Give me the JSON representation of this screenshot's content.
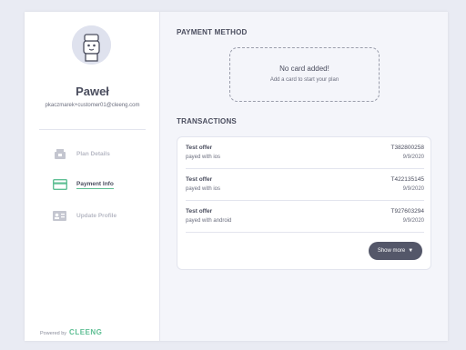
{
  "user": {
    "name": "Paweł",
    "email": "pkaczmarek+customer01@cleeng.com"
  },
  "nav": [
    {
      "label": "Plan Details",
      "icon": "plan-details-icon",
      "active": false
    },
    {
      "label": "Payment Info",
      "icon": "credit-card-icon",
      "active": true
    },
    {
      "label": "Update Profile",
      "icon": "profile-card-icon",
      "active": false
    }
  ],
  "footer": {
    "powered_by": "Powered by",
    "brand": "CLEENG"
  },
  "payment_method": {
    "title": "PAYMENT METHOD",
    "empty_title": "No card added!",
    "empty_subtitle": "Add a card to start your plan"
  },
  "transactions": {
    "title": "TRANSACTIONS",
    "items": [
      {
        "offer": "Test offer",
        "method": "payed with ios",
        "id": "T382800258",
        "date": "9/9/2020"
      },
      {
        "offer": "Test offer",
        "method": "payed with ios",
        "id": "T422135145",
        "date": "9/9/2020"
      },
      {
        "offer": "Test offer",
        "method": "payed with android",
        "id": "T927603294",
        "date": "9/9/2020"
      }
    ],
    "show_more": "Show more",
    "show_more_caret": "▼"
  },
  "colors": {
    "accent": "#5fbf94",
    "background": "#e9ebf3",
    "panel": "#f4f5fa",
    "button": "#545769"
  }
}
